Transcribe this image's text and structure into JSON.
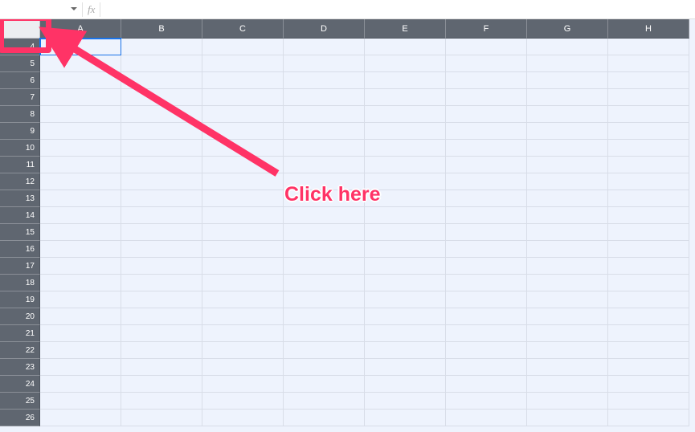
{
  "topbar": {
    "namebox_value": "",
    "fx_label": "fx",
    "formula_value": ""
  },
  "columns": [
    "A",
    "B",
    "C",
    "D",
    "E",
    "F",
    "G",
    "H"
  ],
  "row_start": 4,
  "row_end": 26,
  "selected_cell": {
    "row": 4,
    "col": 0
  },
  "annotation": {
    "label": "Click here"
  }
}
